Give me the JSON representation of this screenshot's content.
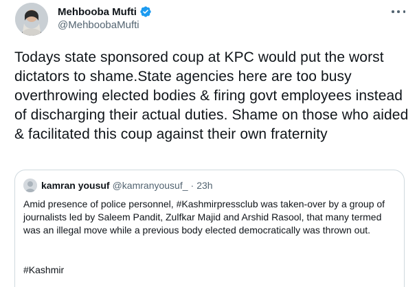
{
  "tweet": {
    "display_name": "Mehbooba Mufti",
    "handle": "@MehboobaMufti",
    "verified_icon": "verified-badge-icon",
    "more_icon": "more-horizontal-icon",
    "text": "Todays state sponsored coup at KPC would put the worst dictators to shame.State agencies here are too busy overthrowing elected bodies & firing govt employees instead of discharging their actual duties. Shame on those who aided & facilitated this coup against their own fraternity"
  },
  "quote": {
    "display_name": "kamran yousuf",
    "handle": "@kamranyousuf_",
    "separator": "·",
    "time": "23h",
    "text": "Amid presence of police personnel, #Kashmirpressclub was taken-over by a group of journalists led by Saleem Pandit, Zulfkar Majid and Arshid Rasool, that many termed was an illegal move while a previous body elected democratically was thrown out.",
    "hashtag_line": "#Kashmir"
  },
  "colors": {
    "verified_blue": "#1d9bf0",
    "secondary_text": "#536471",
    "border": "#cfd9de"
  }
}
